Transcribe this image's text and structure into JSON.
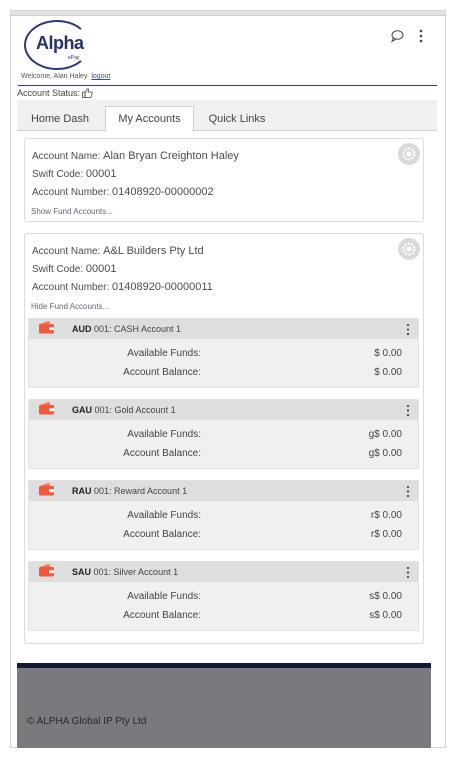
{
  "header": {
    "logo_text": "Alpha",
    "logo_sub": "ePay",
    "welcome_text": "Welcome, Alan Haley",
    "logout_label": "logout"
  },
  "status": {
    "label": "Account Status:",
    "icon": "thumbs-up-icon"
  },
  "tabs": [
    {
      "label": "Home Dash",
      "active": false
    },
    {
      "label": "My Accounts",
      "active": true
    },
    {
      "label": "Quick Links",
      "active": false
    }
  ],
  "accounts": [
    {
      "name_label": "Account Name:",
      "name": "Alan Bryan Creighton Haley",
      "swift_label": "Swift Code:",
      "swift": "00001",
      "number_label": "Account Number:",
      "number": "01408920-00000002",
      "toggle_label": "Show Fund Accounts..."
    },
    {
      "name_label": "Account Name:",
      "name": "A&L Builders Pty Ltd",
      "swift_label": "Swift Code:",
      "swift": "00001",
      "number_label": "Account Number:",
      "number": "01408920-00000011",
      "toggle_label": "Hide Fund Accounts...",
      "funds": [
        {
          "code": "AUD",
          "title": "001: CASH Account 1",
          "available_label": "Available Funds:",
          "available": "$ 0.00",
          "balance_label": "Account Balance:",
          "balance": "$ 0.00"
        },
        {
          "code": "GAU",
          "title": "001: Gold Account 1",
          "available_label": "Available Funds:",
          "available": "g$ 0.00",
          "balance_label": "Account Balance:",
          "balance": "g$ 0.00"
        },
        {
          "code": "RAU",
          "title": "001: Reward Account 1",
          "available_label": "Available Funds:",
          "available": "r$ 0.00",
          "balance_label": "Account Balance:",
          "balance": "r$ 0.00"
        },
        {
          "code": "SAU",
          "title": "001: Silver Account 1",
          "available_label": "Available Funds:",
          "available": "s$ 0.00",
          "balance_label": "Account Balance:",
          "balance": "s$ 0.00"
        }
      ]
    }
  ],
  "footer": {
    "copyright": "© ALPHA Global IP Pty Ltd"
  },
  "colors": {
    "brand": "#2c3a78",
    "wallet": "#ee5a3a",
    "footer_bar": "#101938",
    "footer_bg": "#7a7a7e"
  }
}
